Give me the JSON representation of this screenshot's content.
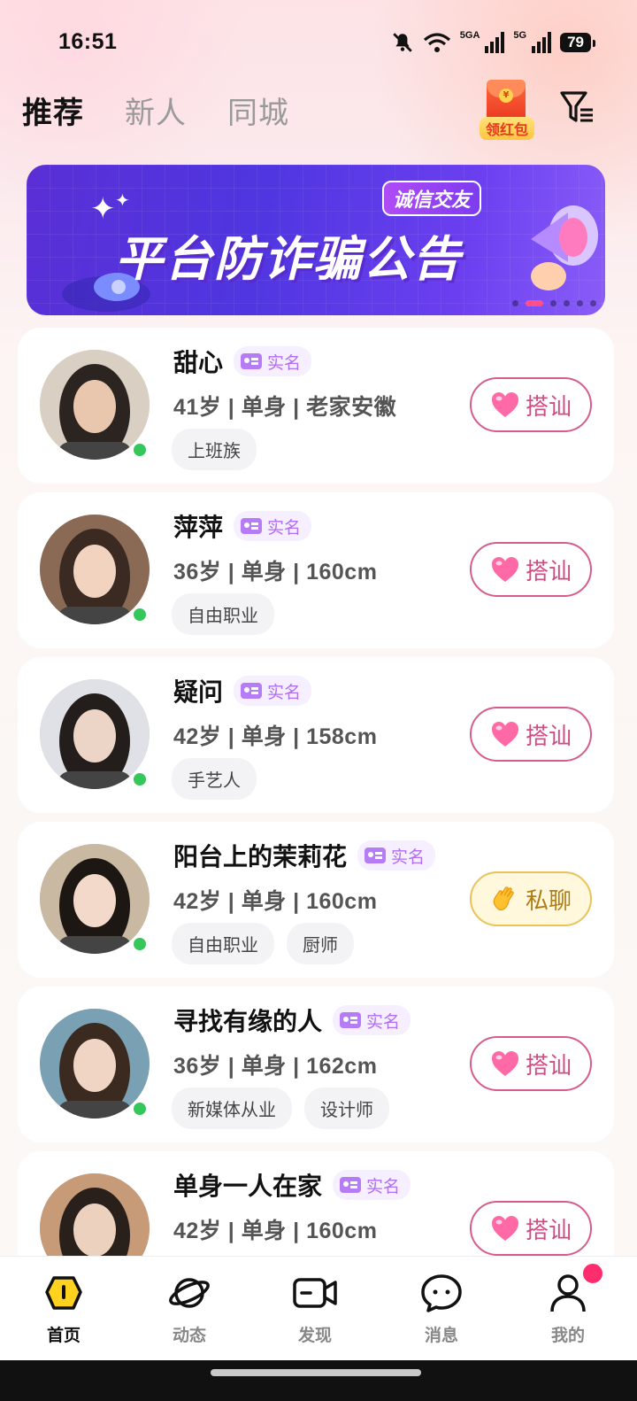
{
  "status_bar": {
    "time": "16:51",
    "signal1": "5GA",
    "signal2": "5G",
    "battery": "79"
  },
  "tabs": [
    {
      "label": "推荐",
      "active": true
    },
    {
      "label": "新人",
      "active": false
    },
    {
      "label": "同城",
      "active": false
    }
  ],
  "red_packet": {
    "label": "领红包",
    "icon": "red-envelope-icon"
  },
  "banner": {
    "title": "平台防诈骗公告",
    "badge": "诚信交友",
    "sparkle": "✦",
    "sparkle_small": "✦",
    "page_count": 6,
    "active_page": 2
  },
  "users": [
    {
      "name": "甜心",
      "verified": "实名",
      "info": "41岁 | 单身 | 老家安徽",
      "tags": [
        "上班族"
      ],
      "action": "搭讪",
      "action_type": "heart"
    },
    {
      "name": "萍萍",
      "verified": "实名",
      "info": "36岁 | 单身 | 160cm",
      "tags": [
        "自由职业"
      ],
      "action": "搭讪",
      "action_type": "heart"
    },
    {
      "name": "疑问",
      "verified": "实名",
      "info": "42岁 | 单身 | 158cm",
      "tags": [
        "手艺人"
      ],
      "action": "搭讪",
      "action_type": "heart"
    },
    {
      "name": "阳台上的茉莉花",
      "verified": "实名",
      "info": "42岁 | 单身 | 160cm",
      "tags": [
        "自由职业",
        "厨师"
      ],
      "action": "私聊",
      "action_type": "wave"
    },
    {
      "name": "寻找有缘的人",
      "verified": "实名",
      "info": "36岁 | 单身 | 162cm",
      "tags": [
        "新媒体从业",
        "设计师"
      ],
      "action": "搭讪",
      "action_type": "heart"
    },
    {
      "name": "单身一人在家",
      "verified": "实名",
      "info": "42岁 | 单身 | 160cm",
      "tags": [],
      "action": "搭讪",
      "action_type": "heart"
    }
  ],
  "bottom_nav": [
    {
      "label": "首页",
      "icon": "home-icon",
      "active": true
    },
    {
      "label": "动态",
      "icon": "planet-icon",
      "active": false
    },
    {
      "label": "发现",
      "icon": "video-icon",
      "active": false
    },
    {
      "label": "消息",
      "icon": "message-icon",
      "active": false
    },
    {
      "label": "我的",
      "icon": "profile-icon",
      "active": false
    }
  ],
  "colors": {
    "accent_pink": "#cf4c84",
    "online": "#35c759",
    "verify_purple": "#b06ef2",
    "banner": "#5a2fd6"
  }
}
